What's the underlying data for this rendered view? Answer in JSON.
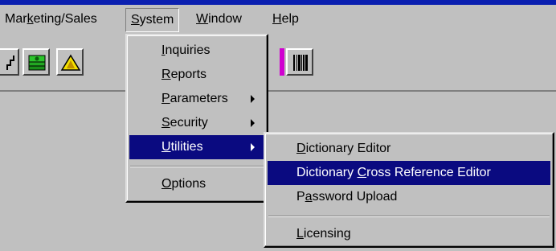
{
  "menubar": {
    "items": [
      {
        "pre": "Mar",
        "ul": "k",
        "post": "eting/Sales"
      },
      {
        "pre": "",
        "ul": "S",
        "post": "ystem"
      },
      {
        "pre": "",
        "ul": "W",
        "post": "indow"
      },
      {
        "pre": "",
        "ul": "H",
        "post": "elp"
      }
    ]
  },
  "toolbar": {
    "buttons": [
      "stairs-icon",
      "money-icon",
      "warning-icon",
      "barcode-icon"
    ]
  },
  "system_menu": {
    "items": [
      {
        "pre": "",
        "ul": "I",
        "post": "nquiries"
      },
      {
        "pre": "",
        "ul": "R",
        "post": "eports"
      },
      {
        "pre": "",
        "ul": "P",
        "post": "arameters"
      },
      {
        "pre": "",
        "ul": "S",
        "post": "ecurity"
      },
      {
        "pre": "",
        "ul": "U",
        "post": "tilities"
      },
      {
        "pre": "",
        "ul": "O",
        "post": "ptions"
      }
    ]
  },
  "utilities_menu": {
    "items": [
      {
        "pre": "",
        "ul": "D",
        "post": "ictionary Editor"
      },
      {
        "pre": "Dictionary ",
        "ul": "C",
        "post": "ross Reference Editor"
      },
      {
        "pre": "P",
        "ul": "a",
        "post": "ssword Upload"
      },
      {
        "pre": "",
        "ul": "L",
        "post": "icensing"
      }
    ]
  },
  "colors": {
    "title_bar": "#0a1fb0",
    "highlight": "#0a0a80",
    "face": "#c0c0c0"
  }
}
